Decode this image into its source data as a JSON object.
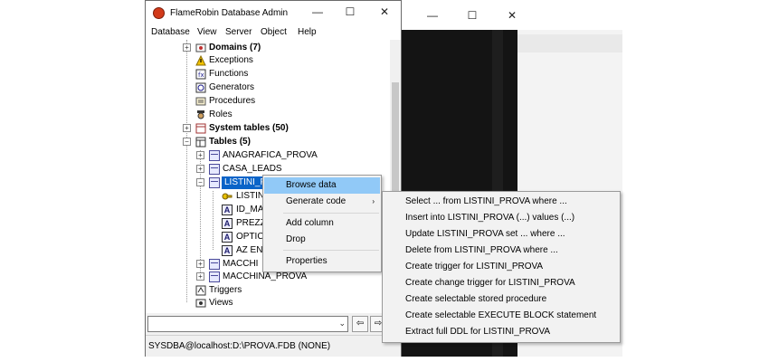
{
  "bg_window": {
    "minimize": "—",
    "maximize": "☐",
    "close": "✕"
  },
  "window": {
    "title": "FlameRobin Database Admin",
    "minimize": "—",
    "maximize": "☐",
    "close": "✕"
  },
  "menu": [
    "Database",
    "View",
    "Server",
    "Object",
    "Help"
  ],
  "tree": {
    "nodes": [
      {
        "label": "Domains (7)",
        "bold": true,
        "icon": "domains-icon",
        "expander": "+"
      },
      {
        "label": "Exceptions",
        "icon": "warning-icon"
      },
      {
        "label": "Functions",
        "icon": "function-icon"
      },
      {
        "label": "Generators",
        "icon": "generator-icon"
      },
      {
        "label": "Procedures",
        "icon": "procedure-icon"
      },
      {
        "label": "Roles",
        "icon": "roles-icon"
      },
      {
        "label": "System tables (50)",
        "bold": true,
        "icon": "system-table-icon",
        "expander": "+"
      },
      {
        "label": "Tables (5)",
        "bold": true,
        "icon": "tables-icon",
        "expander": "-"
      },
      {
        "label": "ANAGRAFICA_PROVA",
        "icon": "table-icon",
        "expander": "+"
      },
      {
        "label": "CASA_LEADS",
        "icon": "table-icon",
        "expander": "+"
      },
      {
        "label": "LISTINI_P",
        "icon": "table-icon",
        "expander": "-",
        "selected": true
      },
      {
        "label": "LISTIN",
        "icon": "key-icon"
      },
      {
        "label": "ID_MA",
        "icon": "column-icon"
      },
      {
        "label": "PREZZ",
        "icon": "column-icon"
      },
      {
        "label": "OPTIC",
        "icon": "column-icon"
      },
      {
        "label": "AZ EN",
        "icon": "column-icon"
      },
      {
        "label": "MACCHI",
        "icon": "table-icon",
        "expander": "+"
      },
      {
        "label": "MACCHINA_PROVA",
        "icon": "table-icon",
        "expander": "+"
      },
      {
        "label": "Triggers",
        "icon": "trigger-icon"
      },
      {
        "label": "Views",
        "icon": "views-icon"
      }
    ]
  },
  "combo_arrow": "⌄",
  "toolbar_buttons": [
    "⇦",
    "⇨"
  ],
  "status": "SYSDBA@localhost:D:\\PROVA.FDB (NONE)",
  "context_menu": {
    "items": [
      {
        "label": "Browse data",
        "highlighted": true
      },
      {
        "label": "Generate code",
        "submenu": true
      },
      {
        "label": "Add column"
      },
      {
        "label": "Drop"
      },
      {
        "label": "Properties"
      }
    ],
    "submenu_arrow": "›"
  },
  "submenu": [
    "Select ... from LISTINI_PROVA where ...",
    "Insert into LISTINI_PROVA (...) values (...)",
    "Update LISTINI_PROVA set ... where ...",
    "Delete from LISTINI_PROVA where ...",
    "Create trigger for LISTINI_PROVA",
    "Create change trigger for LISTINI_PROVA",
    "Create selectable stored procedure",
    "Create selectable EXECUTE BLOCK statement",
    "Extract full DDL for LISTINI_PROVA"
  ],
  "colors": {
    "highlight": "#91c9f7",
    "selection": "#0a64c8",
    "app_icon": "#d23a1a"
  }
}
